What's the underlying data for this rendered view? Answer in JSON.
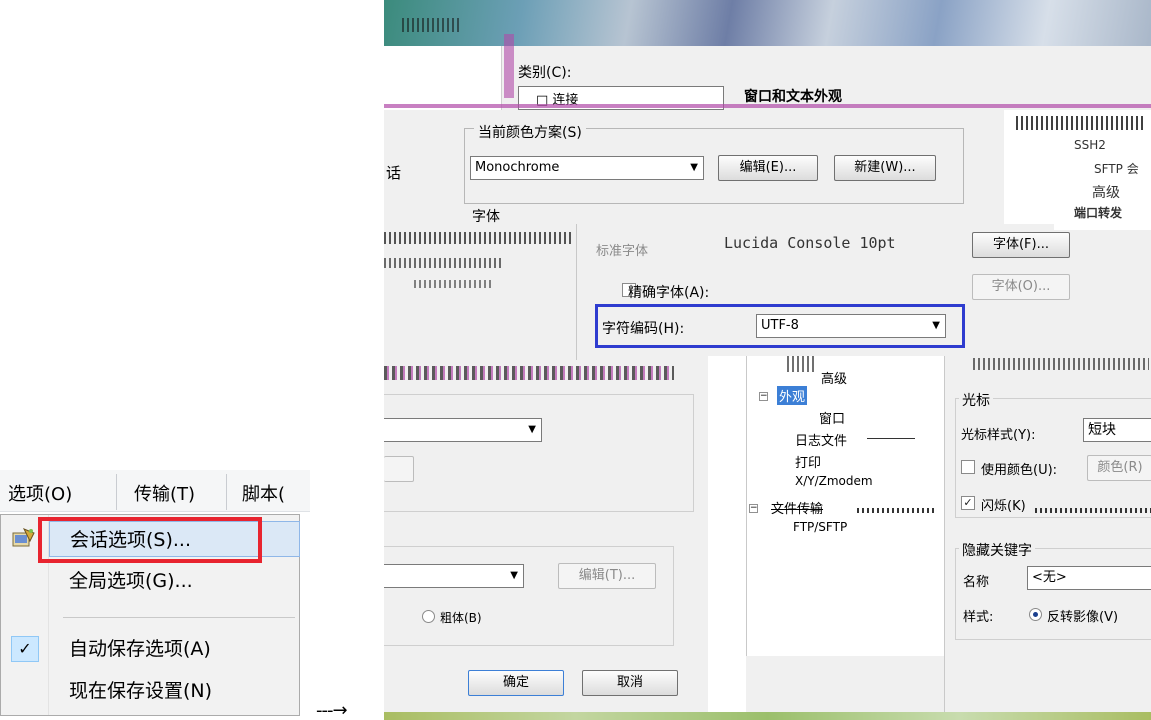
{
  "menu": {
    "bar": [
      "选项(O)",
      "传输(T)",
      "脚本("
    ],
    "items": [
      "会话选项(S)...",
      "全局选项(G)...",
      "自动保存选项(A)",
      "现在保存设置(N)"
    ],
    "check_mark": "✓"
  },
  "arrow": "---→",
  "dialog": {
    "category_label": "类别(C):",
    "category_first": "□ 连接",
    "pane_title": "窗口和文本外观",
    "color_scheme": {
      "legend": "当前颜色方案(S)",
      "value": "Monochrome",
      "edit_label": "编辑(E)...",
      "new_label": "新建(W)..."
    },
    "font": {
      "legend": "字体",
      "standard_label": "标准字体",
      "standard_value": "Lucida Console 10pt",
      "font_button": "字体(F)...",
      "precise_label": "精确字体(A):",
      "precise_button": "字体(O)...",
      "encoding_label": "字符编码(H):",
      "encoding_value": "UTF-8"
    },
    "left_fragments": {
      "session_suffix": "话",
      "edit_disabled": "编辑(T)...",
      "bold_label": "粗体(B)"
    },
    "tree_top_right": [
      "SSH2",
      "SFTP 会",
      "高级",
      "端口转发"
    ],
    "tree": {
      "advanced": "高级",
      "appearance": "外观",
      "window": "窗口",
      "log_file": "日志文件",
      "print": "打印",
      "xyz": "X/Y/Zmodem",
      "file_transfer": "文件传输",
      "ftp": "FTP/SFTP"
    },
    "cursor": {
      "legend": "光标",
      "style_label": "光标样式(Y):",
      "style_value": "短块",
      "use_color_label": "使用颜色(U):",
      "color_button": "颜色(R)",
      "blink_label": "闪烁(K)"
    },
    "hidden_keys": {
      "legend": "隐藏关键字",
      "name_label": "名称",
      "name_value": "<无>",
      "style_label": "样式:",
      "style_value": "反转影像(V)"
    },
    "ok_label": "确定",
    "cancel_label": "取消"
  },
  "colors": {
    "highlight_red": "#e8242f",
    "highlight_blue": "#2e3ccf",
    "selection": "#3c7fd6"
  }
}
